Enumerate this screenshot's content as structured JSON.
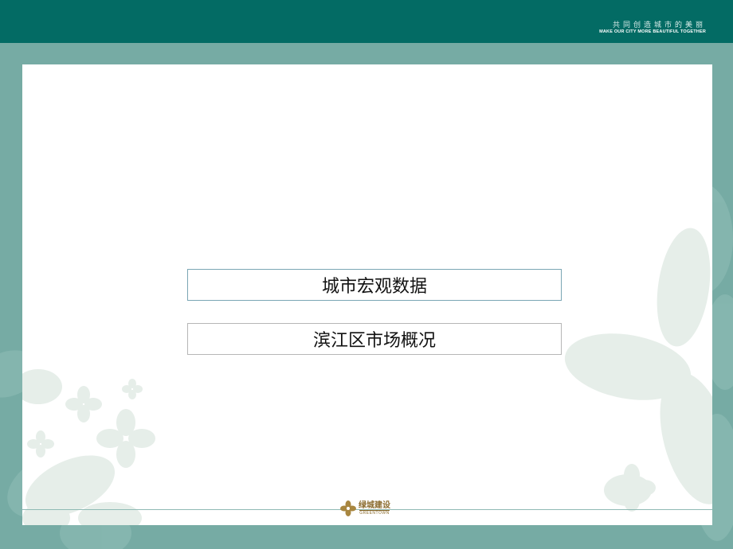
{
  "header": {
    "tagline_cn": "共同创造城市的美丽",
    "tagline_en": "MAKE OUR CITY MORE BEAUTIFUL TOGETHER"
  },
  "menu": {
    "items": [
      {
        "label": "城市宏观数据"
      },
      {
        "label": "滨江区市场概况"
      }
    ]
  },
  "footer": {
    "logo_cn": "绿城建设",
    "logo_en": "GREENTOWN"
  },
  "colors": {
    "header_bg": "#036b64",
    "frame_bg": "#76aba4",
    "slide_bg": "#ffffff",
    "logo_gold": "#8a6a2c"
  }
}
